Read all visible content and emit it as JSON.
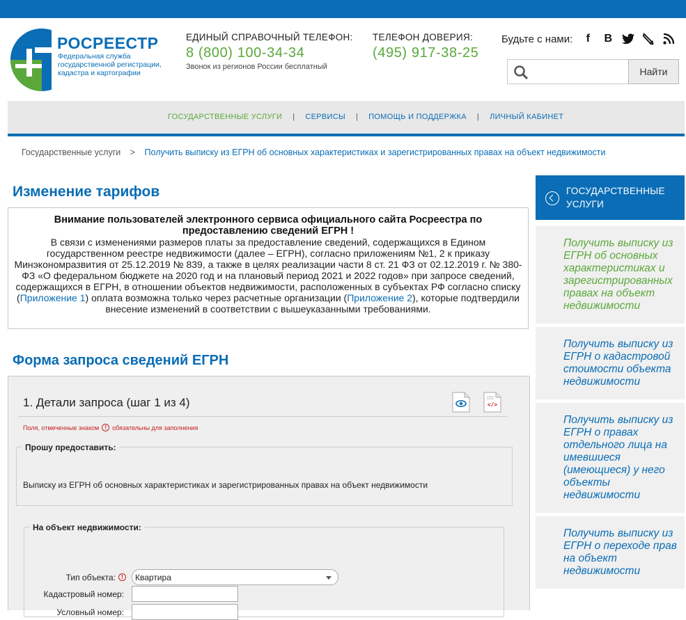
{
  "header": {
    "logo_name": "РОСРЕЕСТР",
    "logo_sub": "Федеральная служба государственной регистрации, кадастра и картографии",
    "phone_label": "ЕДИНЫЙ СПРАВОЧНЫЙ ТЕЛЕФОН:",
    "phone_number": "8 (800) 100-34-34",
    "phone_note": "Звонок из регионов России бесплатный",
    "trust_label": "ТЕЛЕФОН ДОВЕРИЯ:",
    "trust_number": "(495) 917-38-25",
    "social_label": "Будьте с нами:",
    "social_icons": [
      "facebook-icon",
      "vk-icon",
      "twitter-icon",
      "livejournal-icon",
      "rss-icon"
    ],
    "search_placeholder": "",
    "search_button": "Найти"
  },
  "nav": {
    "items": [
      "ГОСУДАРСТВЕННЫЕ УСЛУГИ",
      "СЕРВИСЫ",
      "ПОМОЩЬ И ПОДДЕРЖКА",
      "ЛИЧНЫЙ КАБИНЕТ"
    ],
    "separator": "|"
  },
  "breadcrumb": {
    "home": "Государственные услуги",
    "sep": ">",
    "current": "Получить выписку из ЕГРН об основных характеристиках и зарегистрированных правах на объект недвижимости"
  },
  "tariff": {
    "heading": "Изменение тарифов",
    "title": "Внимание пользователей электронного сервиса официального сайта Росреестра по предоставлению сведений ЕГРН !",
    "body_1": "В связи с изменениями размеров платы за предоставление сведений, содержащихся в Едином государственном реестре недвижимости (далее – ЕГРН), согласно приложениям №1, 2 к приказу Минэкономразвития от 25.12.2019 № 839, а также в целях реализации части 8 ст. 21 ФЗ от 02.12.2019 г. № 380-ФЗ «О федеральном бюджете на 2020 год и на плановый период 2021 и 2022 годов» при запросе сведений, содержащихся в ЕГРН, в отношении объектов недвижимости, расположенных в субъектах РФ согласно списку (",
    "link_1": "Приложение 1",
    "body_2": ") оплата возможна только через расчетные организации (",
    "link_2": "Приложение 2",
    "body_3": "), которые подтвердили внесение изменений в соответствии с вышеуказанными требованиями."
  },
  "form": {
    "heading": "Форма запроса сведений ЕГРН",
    "step_title": "1. Детали запроса (шаг 1 из 4)",
    "req_note_1": "Поля, отмеченные знаком",
    "req_mark": "!",
    "req_note_2": "обязательны для заполнения",
    "request_legend": "Прошу предоставить:",
    "request_text": "Выписку из ЕГРН об основных характеристиках и зарегистрированных правах на объект недвижимости",
    "object_legend": "На объект недвижимости:",
    "type_label": "Тип объекта:",
    "type_value": "Квартира",
    "cadastral_label": "Кадастровый номер:",
    "conditional_label": "Условный номер:"
  },
  "sidebar": {
    "header": "ГОСУДАРСТВЕННЫЕ УСЛУГИ",
    "items": [
      "Получить выписку из ЕГРН об основных характеристиках и зарегистрированных правах на объект недвижимости",
      "Получить выписку из ЕГРН о кадастровой стоимости объекта недвижимости",
      "Получить выписку из ЕГРН о правах отдельного лица на имевшиеся (имеющиеся) у него объекты недвижимости",
      "Получить выписку из ЕГРН о переходе прав на объект недвижимости"
    ]
  },
  "colors": {
    "brand_blue": "#0a6db5",
    "brand_green": "#5aa83a",
    "required_red": "#c62020"
  }
}
